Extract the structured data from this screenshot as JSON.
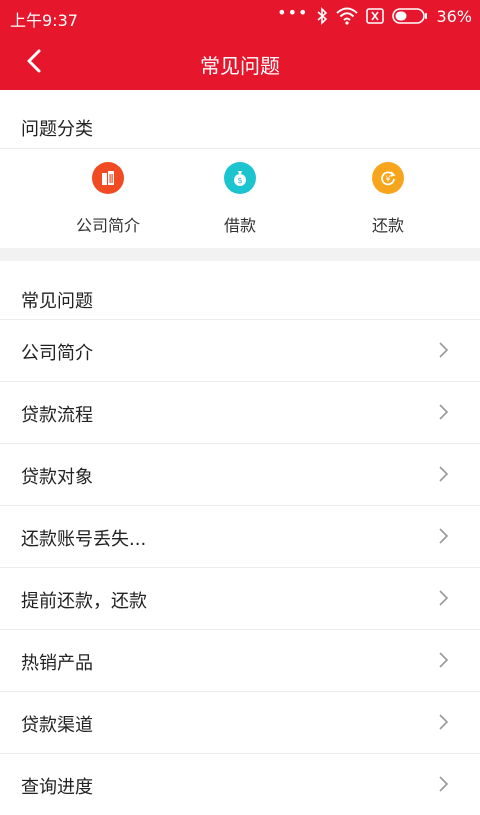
{
  "status_bar": {
    "time": "上午9:37",
    "battery": "36%"
  },
  "nav": {
    "title": "常见问题"
  },
  "categories": {
    "title": "问题分类",
    "items": [
      {
        "label": "公司简介",
        "icon": "building-icon",
        "color": "#f04b23"
      },
      {
        "label": "借款",
        "icon": "money-bag-icon",
        "color": "#1cc4cf"
      },
      {
        "label": "还款",
        "icon": "repay-icon",
        "color": "#f7a51c"
      }
    ]
  },
  "faq": {
    "title": "常见问题",
    "items": [
      {
        "label": "公司简介"
      },
      {
        "label": "贷款流程"
      },
      {
        "label": "贷款对象"
      },
      {
        "label": "还款账号丢失..."
      },
      {
        "label": "提前还款，还款"
      },
      {
        "label": "热销产品"
      },
      {
        "label": "贷款渠道"
      },
      {
        "label": "查询进度"
      }
    ]
  },
  "colors": {
    "brand": "#e6162d",
    "separator": "#f2f2f2"
  }
}
